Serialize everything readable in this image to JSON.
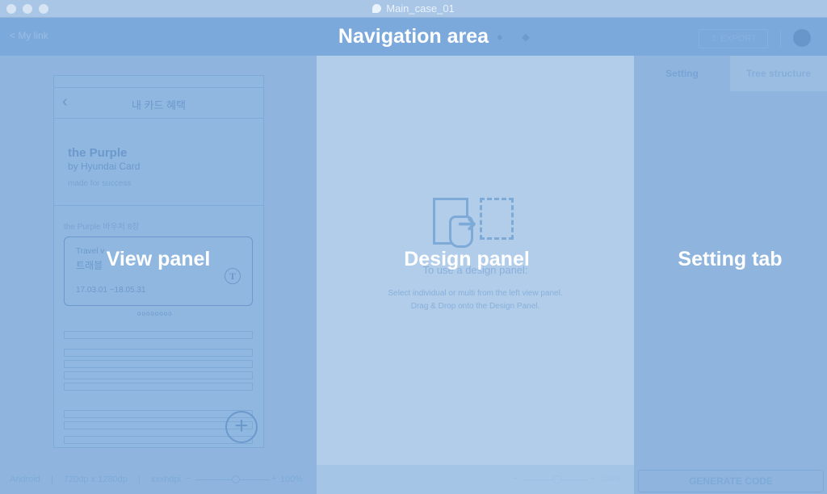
{
  "window": {
    "title": "Main_case_01"
  },
  "nav": {
    "back_label": "< My link",
    "overlay_label": "Navigation area",
    "export_label": "EXPORT"
  },
  "view_panel": {
    "overlay_label": "View panel",
    "phone": {
      "header_title": "내 카드 혜택",
      "back_glyph": "‹",
      "card_name": "the Purple",
      "card_by": "by Hyundai Card",
      "card_tag": "made for success",
      "benefit_title": "the Purple 바우처 8장",
      "ticket_line1": "Travel v",
      "ticket_line2": "트래블",
      "ticket_date": "17.03.01 ~18.05.31",
      "ticket_badge": "T",
      "pager": "oooooooo",
      "fab_glyph": "+"
    },
    "footer": {
      "platform": "Android",
      "resolution": "720dp x 1280dp",
      "density": "xxxhdpi",
      "zoom_minus": "−",
      "zoom_plus": "+",
      "zoom": "100%"
    }
  },
  "design_panel": {
    "overlay_label": "Design panel",
    "instruction_title": "To use a design panel:",
    "instruction_line1": "Select individual or multi from the left view panel.",
    "instruction_line2": "Drag & Drop onto the Design Panel.",
    "zoom_minus": "−",
    "zoom_plus": "+",
    "zoom": "100%"
  },
  "setting_panel": {
    "overlay_label": "Setting tab",
    "tabs": [
      {
        "label": "Setting"
      },
      {
        "label": "Tree structure"
      }
    ],
    "generate_label": "GENERATE CODE"
  },
  "colors": {
    "nav_bar": "#7ba9dc",
    "design_panel": "#b1cde9",
    "side_panels": "#8fb5de"
  }
}
